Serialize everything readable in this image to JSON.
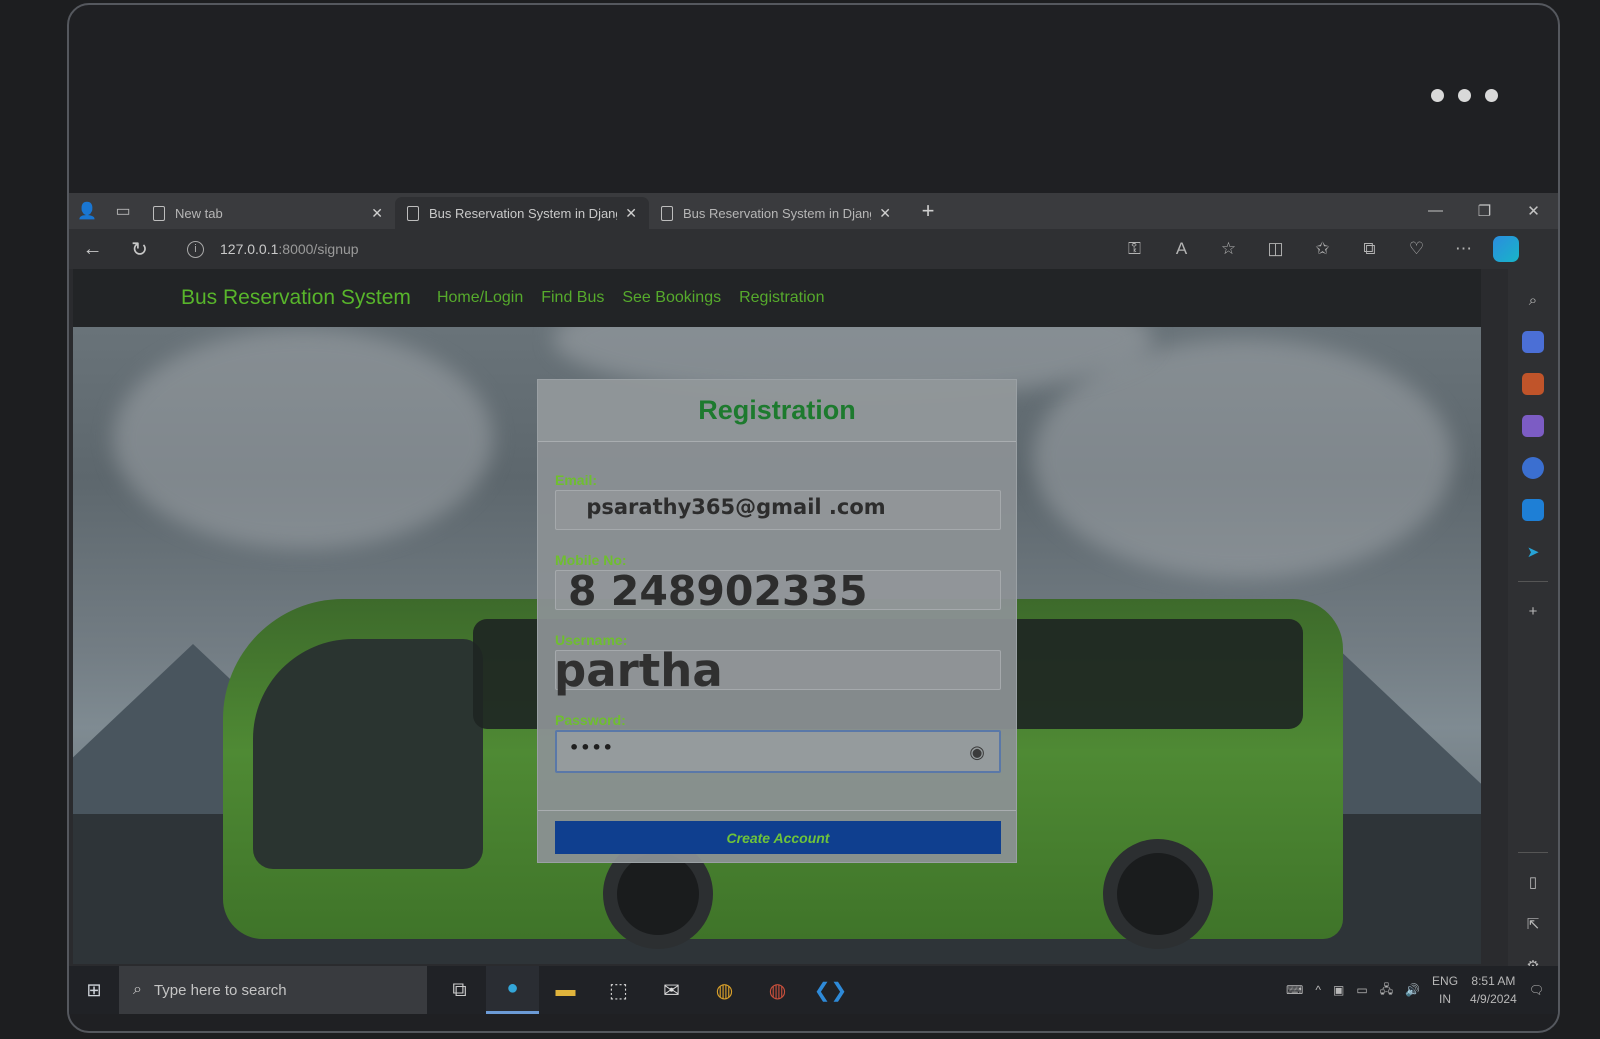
{
  "browser": {
    "tabs": [
      {
        "title": "New tab",
        "close": "✕"
      },
      {
        "title": "Bus Reservation System in Djang",
        "close": "✕"
      },
      {
        "title": "Bus Reservation System in Djang",
        "close": "✕"
      }
    ],
    "new_tab": "+",
    "url_host": "127.0.0.1",
    "url_path": ":8000/signup"
  },
  "site": {
    "brand": "Bus Reservation System",
    "nav": [
      "Home/Login",
      "Find Bus",
      "See Bookings",
      "Registration"
    ]
  },
  "form": {
    "title": "Registration",
    "email_label": "Email:",
    "email_value": "psarathy365@gmail .com",
    "mobile_label": "Mobile No:",
    "mobile_value": "8 248902335",
    "username_label": "Username:",
    "username_value": "partha",
    "password_label": "Password:",
    "password_value": "••••",
    "submit_label": "Create Account"
  },
  "taskbar": {
    "search_placeholder": "Type here to search",
    "lang": "ENG",
    "region": "IN",
    "time": "8:51 AM",
    "date": "4/9/2024"
  },
  "icons": {
    "profile": "profile-icon",
    "eye": "eye-icon"
  },
  "colors": {
    "accent_green": "#58b52b",
    "title_green": "#1d7a2e",
    "button_blue": "#0f3f8f"
  }
}
